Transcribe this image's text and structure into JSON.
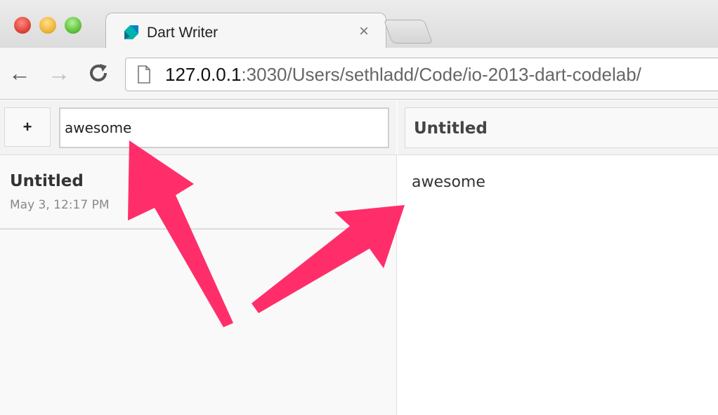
{
  "browser": {
    "tab": {
      "title": "Dart Writer",
      "close_glyph": "×"
    },
    "nav": {
      "back_glyph": "←",
      "forward_glyph": "→",
      "reload_glyph": "C"
    },
    "url": {
      "host": "127.0.0.1",
      "path": ":3030/Users/sethladd/Code/io-2013-dart-codelab/"
    }
  },
  "app": {
    "add_button_label": "+",
    "search_value": "awesome",
    "documents": [
      {
        "title": "Untitled",
        "date": "May 3, 12:17 PM"
      }
    ],
    "editor": {
      "title": "Untitled",
      "body": "awesome"
    }
  },
  "colors": {
    "arrow": "#ff2e6a",
    "dart_logo_teal": "#00b4ab",
    "dart_logo_blue": "#0081c6"
  },
  "icons": [
    "dart-logo-icon",
    "close-icon",
    "back-arrow-icon",
    "forward-arrow-icon",
    "reload-icon",
    "page-icon",
    "annotation-arrow"
  ]
}
